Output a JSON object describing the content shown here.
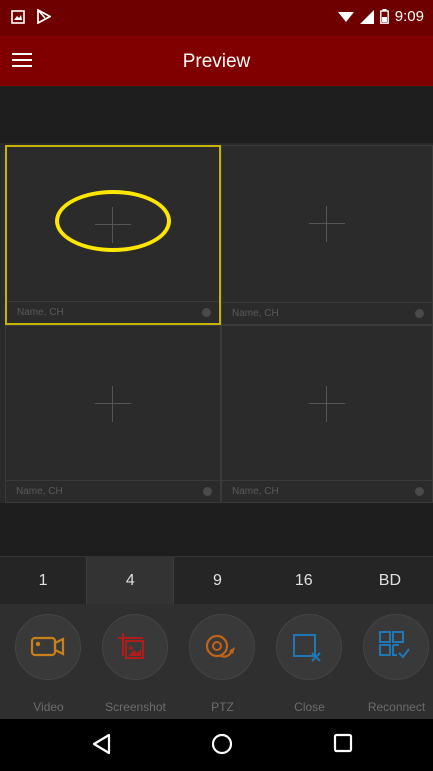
{
  "status_bar": {
    "time": "9:09",
    "icons": [
      "image-icon",
      "play-store-icon",
      "wifi-icon",
      "signal-icon",
      "battery-icon"
    ]
  },
  "app_bar": {
    "title": "Preview",
    "menu_icon": "hamburger-menu-icon"
  },
  "preview_grid": {
    "cells": [
      {
        "label": "Name, CH",
        "selected": true
      },
      {
        "label": "Name, CH",
        "selected": false
      },
      {
        "label": "Name, CH",
        "selected": false
      },
      {
        "label": "Name, CH",
        "selected": false
      }
    ],
    "annotation_color": "#ffe600"
  },
  "split_modes": {
    "options": [
      "1",
      "4",
      "9",
      "16",
      "BD"
    ],
    "selected": "4"
  },
  "toolbar": {
    "items": [
      {
        "label": "Video",
        "icon": "video-camera-icon",
        "color": "#c9801a"
      },
      {
        "label": "Screenshot",
        "icon": "screenshot-icon",
        "color": "#b01c1c"
      },
      {
        "label": "PTZ",
        "icon": "ptz-icon",
        "color": "#c0641a"
      },
      {
        "label": "Close",
        "icon": "close-window-icon",
        "color": "#1f77b4"
      },
      {
        "label": "Reconnect",
        "icon": "reconnect-icon",
        "color": "#1f77b4"
      }
    ]
  },
  "nav_bar": {
    "icons": [
      "back-icon",
      "home-icon",
      "recents-icon"
    ]
  },
  "colors": {
    "status_bar": "#6e0000",
    "app_bar": "#800000",
    "selected_border": "#c8b400"
  }
}
